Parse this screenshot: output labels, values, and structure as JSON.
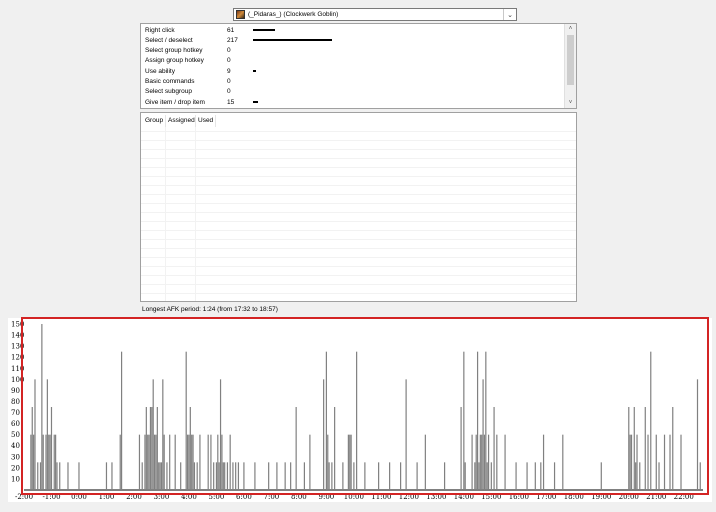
{
  "player_select": {
    "value": "(_Pidaras_) (Clockwerk Goblin)",
    "icon": "hero-portrait-icon"
  },
  "actions": [
    {
      "name": "Right click",
      "count": 61
    },
    {
      "name": "Select / deselect",
      "count": 217
    },
    {
      "name": "Select group hotkey",
      "count": 0
    },
    {
      "name": "Assign group hotkey",
      "count": 0
    },
    {
      "name": "Use ability",
      "count": 9
    },
    {
      "name": "Basic commands",
      "count": 0
    },
    {
      "name": "Select subgroup",
      "count": 0
    },
    {
      "name": "Give item / drop item",
      "count": 15
    }
  ],
  "groups_table": {
    "columns": [
      "Group",
      "Assigned",
      "Used"
    ],
    "rows": []
  },
  "afk": {
    "text": "Longest AFK period: 1:24 (from 17:32 to 18:57)"
  },
  "chart_data": {
    "type": "bar",
    "ylim": [
      0,
      150
    ],
    "yticks": [
      10,
      20,
      30,
      40,
      50,
      60,
      70,
      80,
      90,
      100,
      110,
      120,
      130,
      140,
      150
    ],
    "xlim": [
      -2,
      22.7
    ],
    "xticks": [
      "-2:00",
      "-1:00",
      "0:00",
      "1:00",
      "2:00",
      "3:00",
      "4:00",
      "5:00",
      "6:00",
      "7:00",
      "8:00",
      "9:00",
      "10:00",
      "11:00",
      "12:00",
      "13:00",
      "14:00",
      "15:00",
      "16:00",
      "17:00",
      "18:00",
      "19:00",
      "20:00",
      "21:00",
      "22:00"
    ],
    "x": [
      -1.75,
      -1.7,
      -1.65,
      -1.6,
      -1.5,
      -1.4,
      -1.35,
      -1.3,
      -1.2,
      -1.15,
      -1.1,
      -1.05,
      -1.0,
      -0.9,
      -0.85,
      -0.8,
      -0.7,
      -0.4,
      0.0,
      1.0,
      1.2,
      1.5,
      1.55,
      2.2,
      2.3,
      2.4,
      2.45,
      2.5,
      2.55,
      2.6,
      2.65,
      2.7,
      2.75,
      2.8,
      2.85,
      2.9,
      2.95,
      3.0,
      3.05,
      3.1,
      3.2,
      3.3,
      3.5,
      3.7,
      3.9,
      3.95,
      4.0,
      4.05,
      4.1,
      4.15,
      4.2,
      4.3,
      4.4,
      4.7,
      4.8,
      4.9,
      5.0,
      5.05,
      5.1,
      5.15,
      5.2,
      5.25,
      5.3,
      5.4,
      5.5,
      5.6,
      5.7,
      5.8,
      6.0,
      6.4,
      6.9,
      7.2,
      7.5,
      7.7,
      7.9,
      8.2,
      8.4,
      8.9,
      9.0,
      9.05,
      9.1,
      9.2,
      9.3,
      9.6,
      9.8,
      9.85,
      9.9,
      10.0,
      10.1,
      10.4,
      10.9,
      11.3,
      11.7,
      11.9,
      12.3,
      12.6,
      13.3,
      13.9,
      14.0,
      14.05,
      14.3,
      14.4,
      14.45,
      14.5,
      14.55,
      14.6,
      14.65,
      14.7,
      14.75,
      14.8,
      14.85,
      14.9,
      15.0,
      15.1,
      15.2,
      15.5,
      15.9,
      16.3,
      16.6,
      16.8,
      16.9,
      17.3,
      17.6,
      19.0,
      20.0,
      20.05,
      20.1,
      20.2,
      20.25,
      20.3,
      20.4,
      20.6,
      20.7,
      20.8,
      21.0,
      21.1,
      21.3,
      21.5,
      21.6,
      21.9,
      22.5,
      22.6
    ],
    "values": [
      50,
      75,
      50,
      100,
      25,
      25,
      150,
      50,
      50,
      100,
      50,
      50,
      75,
      50,
      50,
      25,
      25,
      25,
      25,
      25,
      25,
      50,
      125,
      50,
      25,
      50,
      75,
      50,
      50,
      75,
      75,
      100,
      50,
      50,
      75,
      25,
      25,
      25,
      100,
      50,
      25,
      50,
      50,
      25,
      125,
      50,
      50,
      75,
      50,
      50,
      25,
      25,
      50,
      50,
      50,
      25,
      25,
      50,
      25,
      100,
      50,
      25,
      25,
      25,
      50,
      25,
      25,
      25,
      25,
      25,
      25,
      25,
      25,
      25,
      75,
      25,
      50,
      100,
      125,
      50,
      25,
      25,
      75,
      25,
      50,
      50,
      50,
      25,
      125,
      25,
      25,
      25,
      25,
      100,
      25,
      50,
      25,
      75,
      125,
      25,
      50,
      25,
      50,
      125,
      25,
      50,
      50,
      100,
      50,
      125,
      25,
      50,
      25,
      75,
      50,
      50,
      25,
      25,
      25,
      25,
      50,
      25,
      50,
      25,
      75,
      50,
      50,
      75,
      25,
      50,
      25,
      75,
      50,
      125,
      50,
      25,
      50,
      50,
      75,
      50,
      100,
      25,
      50,
      75
    ],
    "xlabel": "",
    "ylabel": "",
    "grid": false,
    "legend": "none",
    "bar_color": "#808080",
    "highlight_color": "#d32424"
  }
}
